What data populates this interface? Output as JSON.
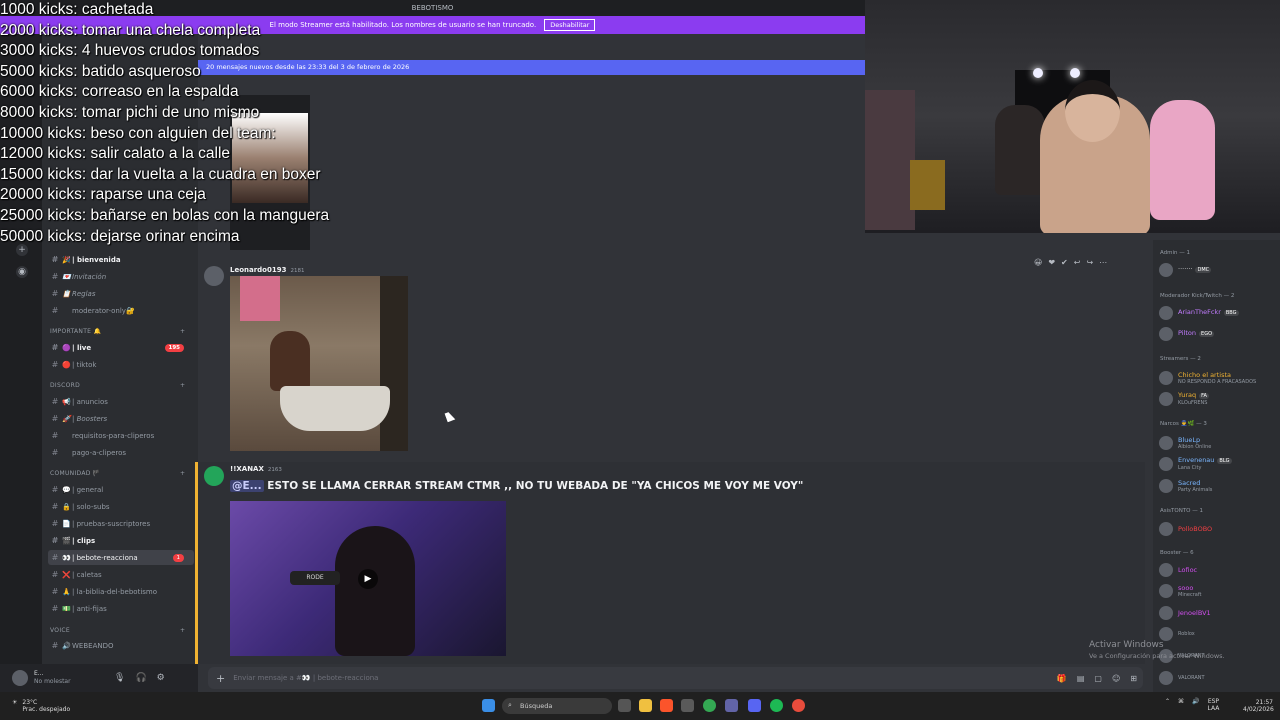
{
  "app": {
    "server_name": "BEBOTISMO",
    "streamer_banner": "El modo Streamer está habilitado. Los nombres de usuario se han truncado.",
    "disable_label": "Deshabilitar",
    "new_messages": "20 mensajes nuevos desde las 23:33 del 3 de febrero de 2026"
  },
  "overlay": {
    "lines": [
      "1000 kicks: cachetada",
      "2000 kicks: tomar una chela completa",
      "3000 kicks: 4 huevos crudos tomados",
      "5000 kicks: batido asqueroso",
      "6000 kicks: correaso en la espalda",
      "8000 kicks: tomar pichi de uno mismo",
      "10000 kicks: beso con alguien del team:",
      "12000 kicks: salir calato a la calle",
      "15000 kicks: dar la vuelta a la cuadra en boxer",
      "20000 kicks: raparse una ceja",
      "25000 kicks: bañarse en bolas con la manguera",
      "50000 kicks: dejarse orinar encima"
    ]
  },
  "sidebar": {
    "channels": [
      {
        "emoji": "🎉",
        "label": "| bienvenida",
        "style": "bold"
      },
      {
        "emoji": "💌",
        "label": "Invitación",
        "style": "italic"
      },
      {
        "emoji": "📋",
        "label": "Reglas",
        "style": "italic"
      },
      {
        "emoji": "",
        "label": "moderator-only🔐",
        "style": ""
      }
    ],
    "cat_importante": "IMPORTANTE 🔔",
    "important": [
      {
        "emoji": "🟣",
        "label": "| live",
        "style": "bold",
        "badge": "195"
      },
      {
        "emoji": "🔴",
        "label": "| tiktok",
        "style": ""
      }
    ],
    "cat_discord": "DISCORD",
    "discord": [
      {
        "emoji": "📢",
        "label": "| anuncios",
        "style": ""
      },
      {
        "emoji": "🚀",
        "label": "| Boosters",
        "style": "italic"
      },
      {
        "emoji": "",
        "label": "requisitos-para-cliperos",
        "style": ""
      },
      {
        "emoji": "",
        "label": "pago-a-cliperos",
        "style": ""
      }
    ],
    "cat_comunidad": "COMUNIDAD 🏴",
    "comunidad": [
      {
        "emoji": "💬",
        "label": "| general",
        "style": ""
      },
      {
        "emoji": "🔒",
        "label": "| solo-subs",
        "style": ""
      },
      {
        "emoji": "📄",
        "label": "| pruebas-suscriptores",
        "style": ""
      },
      {
        "emoji": "🎬",
        "label": "| clips",
        "style": "bold"
      },
      {
        "emoji": "👀",
        "label": "| bebote-reacciona",
        "style": "active",
        "badge": "1"
      },
      {
        "emoji": "❌",
        "label": "| caletas",
        "style": ""
      },
      {
        "emoji": "🙏",
        "label": "| la-biblia-del-bebotismo",
        "style": ""
      },
      {
        "emoji": "💵",
        "label": "| anti-fijas",
        "style": ""
      }
    ],
    "cat_voice": "VOICE",
    "voice": [
      {
        "emoji": "🔊",
        "label": "WEBEANDO"
      }
    ]
  },
  "user": {
    "name": "E...",
    "status": "No molestar"
  },
  "messages": [
    {
      "author": "Leonardo0193",
      "num": "2181"
    },
    {
      "author": "!!XANAX",
      "num": "2163",
      "mention": "@E...",
      "text": " ESTO SE LLAMA CERRAR  STREAM   CTMR ,, NO TU WEBADA DE \"YA CHICOS ME VOY ME VOY\""
    }
  ],
  "composer": {
    "placeholder": "Enviar mensaje a #👀 | bebote-reacciona"
  },
  "members": {
    "groups": [
      {
        "label": "Admin — 1"
      },
      {
        "label": "Moderador Kick/Twitch — 2"
      },
      {
        "label": "Streamers — 2"
      },
      {
        "label": "Narcos 👮🌿 — 3"
      },
      {
        "label": "AsisTONTO — 1"
      },
      {
        "label": "Booster — 6"
      }
    ],
    "list": [
      {
        "name": "·······",
        "sub": "",
        "tag": "DMC",
        "color": "#dbdee1"
      },
      {
        "name": "ArianTheFckr",
        "sub": "",
        "tag": "BBG",
        "color": "#c27cff"
      },
      {
        "name": "Pilton",
        "sub": "",
        "tag": "EGO",
        "color": "#c27cff"
      },
      {
        "name": "Chicho el artista",
        "sub": "NO RESPONDO A FRACASADOS",
        "tag": "",
        "color": "#f0b232"
      },
      {
        "name": "Yuraq",
        "sub": "KLOuFRENS",
        "tag": "FA",
        "color": "#f0b232"
      },
      {
        "name": "BlueLp",
        "sub": "Albion Online",
        "tag": "",
        "color": "#7ab6ff"
      },
      {
        "name": "Envenenau",
        "sub": "Lana City",
        "tag": "BLG",
        "color": "#7ab6ff"
      },
      {
        "name": "Sacred",
        "sub": "Party Animals",
        "tag": "",
        "color": "#7ab6ff"
      },
      {
        "name": "PolloBOBO",
        "sub": "",
        "tag": "",
        "color": "#f23f43"
      },
      {
        "name": "Lofioc",
        "sub": "",
        "tag": "",
        "color": "#d24ff0"
      },
      {
        "name": "sooo",
        "sub": "Minecraft",
        "tag": "",
        "color": "#d24ff0"
      },
      {
        "name": "JenoelBV1",
        "sub": "",
        "tag": "",
        "color": "#d24ff0"
      },
      {
        "name": "",
        "sub": "Roblox",
        "tag": "",
        "color": "#d24ff0"
      },
      {
        "name": "",
        "sub": "VALORANT",
        "tag": "",
        "color": "#d24ff0"
      },
      {
        "name": "",
        "sub": "VALORANT",
        "tag": "",
        "color": "#d24ff0"
      }
    ]
  },
  "watermark": {
    "title": "Activar Windows",
    "sub": "Ve a Configuración para activar Windows."
  },
  "taskbar": {
    "temp": "23°C",
    "weather": "Prac. despejado",
    "search": "Búsqueda",
    "lang": "ESP",
    "lang2": "LAA",
    "time": "21:57",
    "date": "4/02/2026"
  }
}
